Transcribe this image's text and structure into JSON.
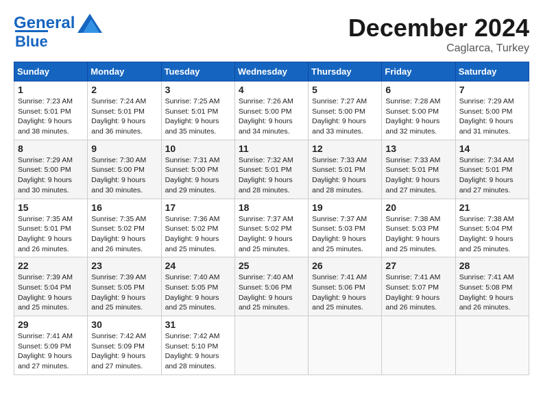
{
  "header": {
    "logo_line1": "General",
    "logo_line2": "Blue",
    "month": "December 2024",
    "location": "Caglarca, Turkey"
  },
  "days_of_week": [
    "Sunday",
    "Monday",
    "Tuesday",
    "Wednesday",
    "Thursday",
    "Friday",
    "Saturday"
  ],
  "weeks": [
    [
      {
        "day": "1",
        "info": "Sunrise: 7:23 AM\nSunset: 5:01 PM\nDaylight: 9 hours and 38 minutes."
      },
      {
        "day": "2",
        "info": "Sunrise: 7:24 AM\nSunset: 5:01 PM\nDaylight: 9 hours and 36 minutes."
      },
      {
        "day": "3",
        "info": "Sunrise: 7:25 AM\nSunset: 5:01 PM\nDaylight: 9 hours and 35 minutes."
      },
      {
        "day": "4",
        "info": "Sunrise: 7:26 AM\nSunset: 5:00 PM\nDaylight: 9 hours and 34 minutes."
      },
      {
        "day": "5",
        "info": "Sunrise: 7:27 AM\nSunset: 5:00 PM\nDaylight: 9 hours and 33 minutes."
      },
      {
        "day": "6",
        "info": "Sunrise: 7:28 AM\nSunset: 5:00 PM\nDaylight: 9 hours and 32 minutes."
      },
      {
        "day": "7",
        "info": "Sunrise: 7:29 AM\nSunset: 5:00 PM\nDaylight: 9 hours and 31 minutes."
      }
    ],
    [
      {
        "day": "8",
        "info": "Sunrise: 7:29 AM\nSunset: 5:00 PM\nDaylight: 9 hours and 30 minutes."
      },
      {
        "day": "9",
        "info": "Sunrise: 7:30 AM\nSunset: 5:00 PM\nDaylight: 9 hours and 30 minutes."
      },
      {
        "day": "10",
        "info": "Sunrise: 7:31 AM\nSunset: 5:00 PM\nDaylight: 9 hours and 29 minutes."
      },
      {
        "day": "11",
        "info": "Sunrise: 7:32 AM\nSunset: 5:01 PM\nDaylight: 9 hours and 28 minutes."
      },
      {
        "day": "12",
        "info": "Sunrise: 7:33 AM\nSunset: 5:01 PM\nDaylight: 9 hours and 28 minutes."
      },
      {
        "day": "13",
        "info": "Sunrise: 7:33 AM\nSunset: 5:01 PM\nDaylight: 9 hours and 27 minutes."
      },
      {
        "day": "14",
        "info": "Sunrise: 7:34 AM\nSunset: 5:01 PM\nDaylight: 9 hours and 27 minutes."
      }
    ],
    [
      {
        "day": "15",
        "info": "Sunrise: 7:35 AM\nSunset: 5:01 PM\nDaylight: 9 hours and 26 minutes."
      },
      {
        "day": "16",
        "info": "Sunrise: 7:35 AM\nSunset: 5:02 PM\nDaylight: 9 hours and 26 minutes."
      },
      {
        "day": "17",
        "info": "Sunrise: 7:36 AM\nSunset: 5:02 PM\nDaylight: 9 hours and 25 minutes."
      },
      {
        "day": "18",
        "info": "Sunrise: 7:37 AM\nSunset: 5:02 PM\nDaylight: 9 hours and 25 minutes."
      },
      {
        "day": "19",
        "info": "Sunrise: 7:37 AM\nSunset: 5:03 PM\nDaylight: 9 hours and 25 minutes."
      },
      {
        "day": "20",
        "info": "Sunrise: 7:38 AM\nSunset: 5:03 PM\nDaylight: 9 hours and 25 minutes."
      },
      {
        "day": "21",
        "info": "Sunrise: 7:38 AM\nSunset: 5:04 PM\nDaylight: 9 hours and 25 minutes."
      }
    ],
    [
      {
        "day": "22",
        "info": "Sunrise: 7:39 AM\nSunset: 5:04 PM\nDaylight: 9 hours and 25 minutes."
      },
      {
        "day": "23",
        "info": "Sunrise: 7:39 AM\nSunset: 5:05 PM\nDaylight: 9 hours and 25 minutes."
      },
      {
        "day": "24",
        "info": "Sunrise: 7:40 AM\nSunset: 5:05 PM\nDaylight: 9 hours and 25 minutes."
      },
      {
        "day": "25",
        "info": "Sunrise: 7:40 AM\nSunset: 5:06 PM\nDaylight: 9 hours and 25 minutes."
      },
      {
        "day": "26",
        "info": "Sunrise: 7:41 AM\nSunset: 5:06 PM\nDaylight: 9 hours and 25 minutes."
      },
      {
        "day": "27",
        "info": "Sunrise: 7:41 AM\nSunset: 5:07 PM\nDaylight: 9 hours and 26 minutes."
      },
      {
        "day": "28",
        "info": "Sunrise: 7:41 AM\nSunset: 5:08 PM\nDaylight: 9 hours and 26 minutes."
      }
    ],
    [
      {
        "day": "29",
        "info": "Sunrise: 7:41 AM\nSunset: 5:09 PM\nDaylight: 9 hours and 27 minutes."
      },
      {
        "day": "30",
        "info": "Sunrise: 7:42 AM\nSunset: 5:09 PM\nDaylight: 9 hours and 27 minutes."
      },
      {
        "day": "31",
        "info": "Sunrise: 7:42 AM\nSunset: 5:10 PM\nDaylight: 9 hours and 28 minutes."
      },
      {
        "day": "",
        "info": ""
      },
      {
        "day": "",
        "info": ""
      },
      {
        "day": "",
        "info": ""
      },
      {
        "day": "",
        "info": ""
      }
    ]
  ]
}
